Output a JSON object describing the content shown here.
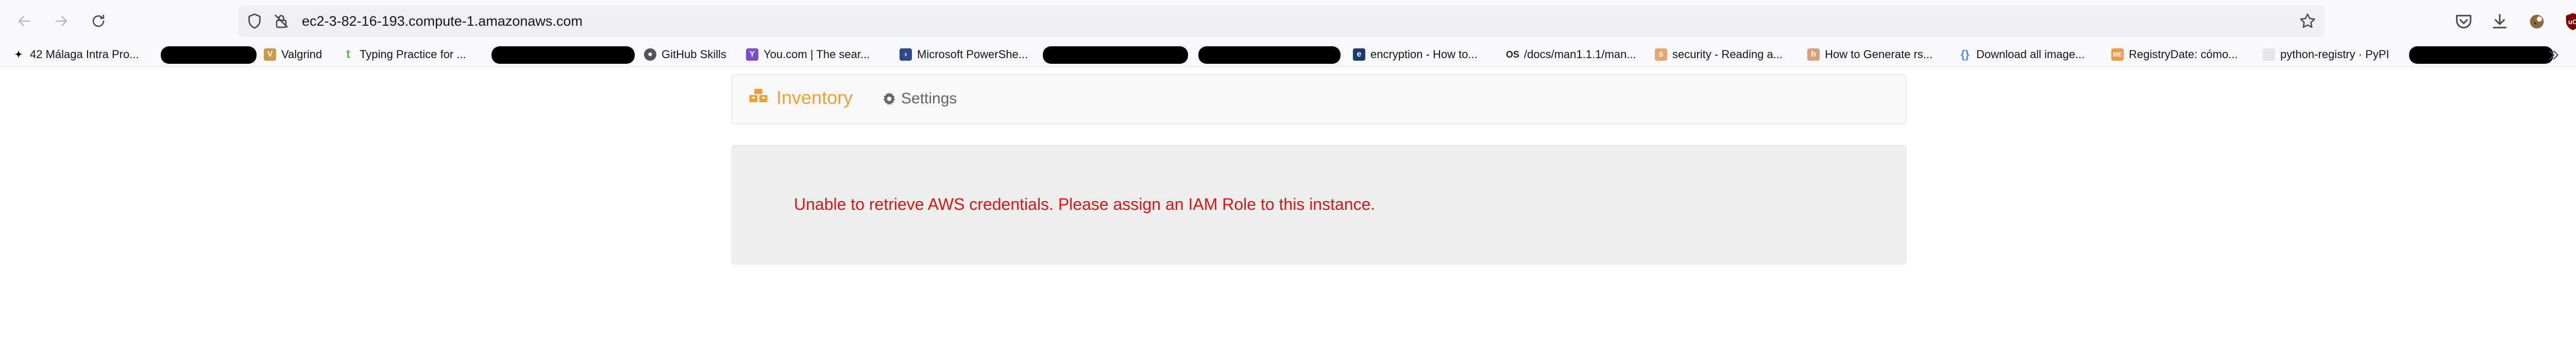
{
  "browser": {
    "url": "ec2-3-82-16-193.compute-1.amazonaws.com",
    "bookmarks": [
      {
        "label": "42 Málaga Intra Pro...",
        "icon": "42-icon",
        "color": "#000000"
      },
      {
        "label": "Valgrind",
        "icon": "valgrind-icon",
        "color": "#8a6d3b"
      },
      {
        "label": "Typing Practice for ...",
        "icon": "typing-icon",
        "color": "#5fb84a"
      },
      {
        "label": "GitHub Skills",
        "icon": "github-icon",
        "color": "#555555"
      },
      {
        "label": "You.com | The sear...",
        "icon": "you-icon",
        "color": "#7a4dd8"
      },
      {
        "label": "Microsoft PowerShe...",
        "icon": "powershell-icon",
        "color": "#2b4a8c"
      },
      {
        "label": "encryption - How to...",
        "icon": "document-icon",
        "color": "#1a3d6e"
      },
      {
        "label": "/docs/man1.1.1/man...",
        "icon": "openssl-icon",
        "color": "#222222"
      },
      {
        "label": "security - Reading a...",
        "icon": "stackexchange-icon",
        "color": "#e8a56c"
      },
      {
        "label": "How to Generate rs...",
        "icon": "web-icon",
        "color": "#d8a07a"
      },
      {
        "label": "Download all image...",
        "icon": "braces-icon",
        "color": "#4a90e2"
      },
      {
        "label": "RegistryDate: cómo...",
        "icon": "registry-icon",
        "color": "#f39a3e"
      },
      {
        "label": "python-registry · PyPI",
        "icon": "pypi-icon",
        "color": "#dddddd"
      }
    ]
  },
  "page": {
    "brand": "Inventory",
    "settings": "Settings",
    "error_message": "Unable to retrieve AWS credentials. Please assign an IAM Role to this instance."
  },
  "colors": {
    "brand": "#f0a030",
    "error": "#e3140f"
  }
}
